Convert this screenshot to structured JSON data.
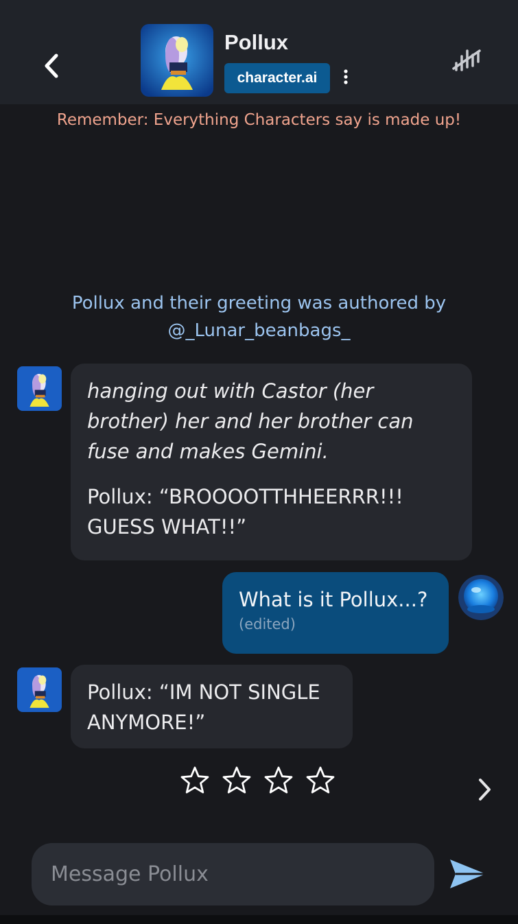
{
  "header": {
    "character_name": "Pollux",
    "creator_badge": "character.ai"
  },
  "disclaimer": "Remember: Everything Characters say is made up!",
  "author_note": {
    "line1": "Pollux and their greeting was authored by",
    "line2": "@_Lunar_beanbags_"
  },
  "messages": [
    {
      "sender": "Pollux",
      "paragraphs": [
        "hanging out with Castor (her brother) her and her brother can fuse and makes Gemini.",
        "Pollux: “BROOOOTTHHEERRR!!! GUESS WHAT!!”"
      ]
    },
    {
      "sender": "user",
      "text": "What is it Pollux...?",
      "status": "(edited)"
    },
    {
      "sender": "Pollux",
      "paragraphs": [
        "Pollux: “IM NOT SINGLE ANYMORE!”"
      ]
    }
  ],
  "rating": {
    "max": 4,
    "value": 0
  },
  "composer": {
    "placeholder": "Message Pollux"
  },
  "colors": {
    "background": "#18191d",
    "header": "#202329",
    "badge": "#0c5a91",
    "user_bubble": "#0a4c7c",
    "bot_bubble": "#26282e",
    "disclaimer": "#f0a48e",
    "author_note": "#9cc4ef",
    "send": "#8ec4f2"
  },
  "icons": {
    "back": "chevron-left-icon",
    "more": "vertical-dots-icon",
    "history": "history-slash-icon",
    "star": "star-outline-icon",
    "next": "chevron-right-icon",
    "send": "paper-plane-icon"
  }
}
